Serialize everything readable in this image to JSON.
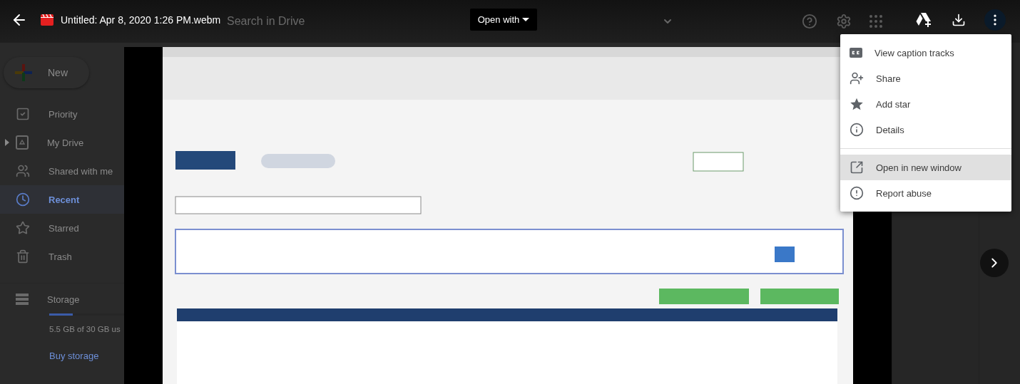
{
  "top_bar": {
    "title": "Untitled: Apr 8, 2020 1:26 PM.webm",
    "open_with": "Open with"
  },
  "drive": {
    "search_placeholder": "Search in Drive",
    "new_button": "New",
    "nav": [
      {
        "label": "Priority",
        "selected": false,
        "expandable": false
      },
      {
        "label": "My Drive",
        "selected": false,
        "expandable": true
      },
      {
        "label": "Shared with me",
        "selected": false,
        "expandable": false
      },
      {
        "label": "Recent",
        "selected": true,
        "expandable": false
      },
      {
        "label": "Starred",
        "selected": false,
        "expandable": false
      },
      {
        "label": "Trash",
        "selected": false,
        "expandable": false
      }
    ],
    "storage": {
      "label": "Storage",
      "level": 0.3,
      "usage": "5.5 GB of 30 GB us",
      "buy": "Buy storage"
    }
  },
  "menu": {
    "groups": [
      [
        {
          "label": "View caption tracks",
          "selected": false
        },
        {
          "label": "Share",
          "selected": false
        },
        {
          "label": "Add star",
          "selected": false
        },
        {
          "label": "Details",
          "selected": false
        }
      ],
      [
        {
          "label": "Open in new window",
          "selected": true
        },
        {
          "label": "Report abuse",
          "selected": false
        }
      ]
    ]
  }
}
